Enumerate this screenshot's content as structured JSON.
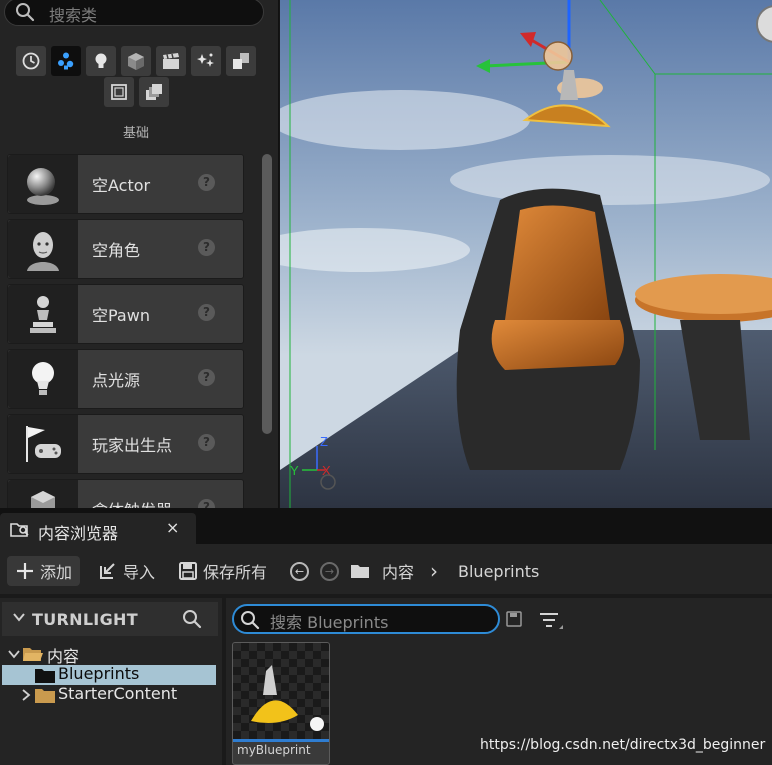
{
  "place_actors": {
    "search_placeholder": "搜索类",
    "categories": [
      {
        "icon": "clock-icon",
        "active": false
      },
      {
        "icon": "basic-shapes-icon",
        "active": true
      },
      {
        "icon": "lightbulb-icon",
        "active": false
      },
      {
        "icon": "cube-icon",
        "active": false
      },
      {
        "icon": "cinematic-clapper-icon",
        "active": false
      },
      {
        "icon": "visual-effects-icon",
        "active": false
      },
      {
        "icon": "geometry-icon",
        "active": false
      },
      {
        "icon": "volumes-icon",
        "active": false
      },
      {
        "icon": "all-classes-icon",
        "active": false
      }
    ],
    "section_title": "基础",
    "items": [
      {
        "label": "空Actor",
        "icon": "sphere-actor-icon"
      },
      {
        "label": "空角色",
        "icon": "character-head-icon"
      },
      {
        "label": "空Pawn",
        "icon": "pawn-icon"
      },
      {
        "label": "点光源",
        "icon": "point-light-icon"
      },
      {
        "label": "玩家出生点",
        "icon": "player-start-flag-icon"
      },
      {
        "label": "盒体触发器",
        "icon": "box-trigger-icon"
      }
    ],
    "help_glyph": "?"
  },
  "viewport": {
    "axis_labels": {
      "z": "Z",
      "y": "Y",
      "x": "X"
    }
  },
  "content_browser": {
    "tab_title": "内容浏览器",
    "tab_close": "×",
    "toolbar": {
      "add_label": "添加",
      "import_label": "导入",
      "save_all_label": "保存所有",
      "breadcrumb": [
        "内容",
        "Blueprints"
      ],
      "separator": "›",
      "back_glyph": "←",
      "forward_glyph": "→"
    },
    "sources": {
      "project_name": "TURNLIGHT",
      "tree": [
        {
          "label": "内容",
          "expanded": true,
          "selected": false
        },
        {
          "label": "Blueprints",
          "expanded": false,
          "selected": true
        },
        {
          "label": "StarterContent",
          "expanded": false,
          "selected": false
        }
      ]
    },
    "assets": {
      "search_placeholder": "搜索 Blueprints",
      "items": [
        {
          "name": "myBlueprint",
          "type_color": "#2f7dd1"
        }
      ]
    }
  },
  "watermark": "https://blog.csdn.net/directx3d_beginner",
  "colors": {
    "accent": "#2e8bd6",
    "selection": "#a6c4d3",
    "panel": "#242424"
  }
}
